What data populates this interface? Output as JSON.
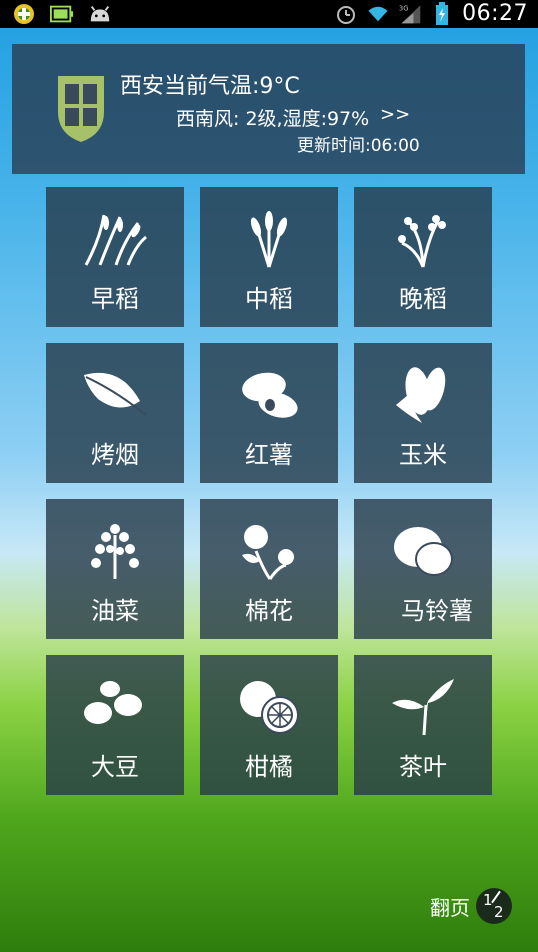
{
  "statusbar": {
    "clock": "06:27",
    "network_label": "3G"
  },
  "weather": {
    "city_temp": "西安当前气温:9°C",
    "wind_humidity": "西南风: 2级,湿度:97%",
    "more": ">>",
    "update_time": "更新时间:06:00"
  },
  "crops": [
    {
      "label": "早稻",
      "icon": "rice-plant-icon"
    },
    {
      "label": "中稻",
      "icon": "wheat-ears-icon"
    },
    {
      "label": "晚稻",
      "icon": "rice-grain-icon"
    },
    {
      "label": "烤烟",
      "icon": "tobacco-leaf-icon"
    },
    {
      "label": "红薯",
      "icon": "sweet-potato-icon"
    },
    {
      "label": "玉米",
      "icon": "corn-icon"
    },
    {
      "label": "油菜",
      "icon": "rapeseed-icon"
    },
    {
      "label": "棉花",
      "icon": "cotton-icon"
    },
    {
      "label": "马铃薯",
      "icon": "potato-icon"
    },
    {
      "label": "大豆",
      "icon": "soybean-icon"
    },
    {
      "label": "柑橘",
      "icon": "citrus-icon"
    },
    {
      "label": "茶叶",
      "icon": "tea-leaf-icon"
    }
  ],
  "pager": {
    "label": "翻页",
    "current": "1",
    "total": "2"
  }
}
